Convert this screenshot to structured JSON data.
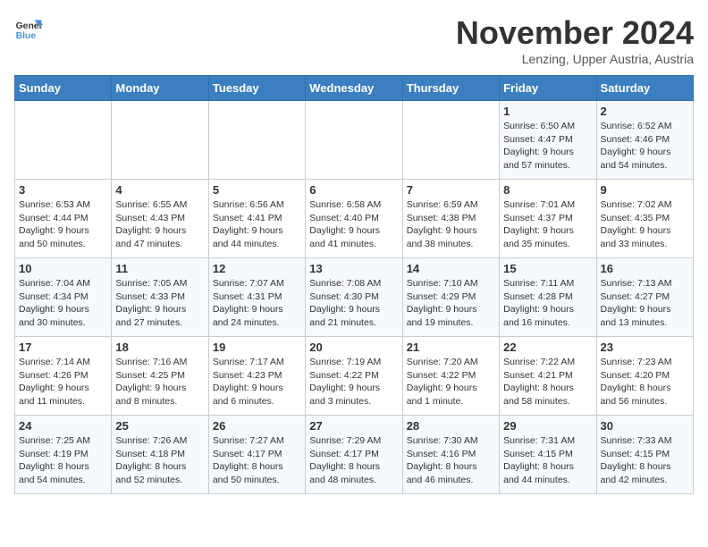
{
  "header": {
    "logo_line1": "General",
    "logo_line2": "Blue",
    "month_title": "November 2024",
    "location": "Lenzing, Upper Austria, Austria"
  },
  "days_of_week": [
    "Sunday",
    "Monday",
    "Tuesday",
    "Wednesday",
    "Thursday",
    "Friday",
    "Saturday"
  ],
  "weeks": [
    [
      {
        "day": "",
        "info": ""
      },
      {
        "day": "",
        "info": ""
      },
      {
        "day": "",
        "info": ""
      },
      {
        "day": "",
        "info": ""
      },
      {
        "day": "",
        "info": ""
      },
      {
        "day": "1",
        "info": "Sunrise: 6:50 AM\nSunset: 4:47 PM\nDaylight: 9 hours\nand 57 minutes."
      },
      {
        "day": "2",
        "info": "Sunrise: 6:52 AM\nSunset: 4:46 PM\nDaylight: 9 hours\nand 54 minutes."
      }
    ],
    [
      {
        "day": "3",
        "info": "Sunrise: 6:53 AM\nSunset: 4:44 PM\nDaylight: 9 hours\nand 50 minutes."
      },
      {
        "day": "4",
        "info": "Sunrise: 6:55 AM\nSunset: 4:43 PM\nDaylight: 9 hours\nand 47 minutes."
      },
      {
        "day": "5",
        "info": "Sunrise: 6:56 AM\nSunset: 4:41 PM\nDaylight: 9 hours\nand 44 minutes."
      },
      {
        "day": "6",
        "info": "Sunrise: 6:58 AM\nSunset: 4:40 PM\nDaylight: 9 hours\nand 41 minutes."
      },
      {
        "day": "7",
        "info": "Sunrise: 6:59 AM\nSunset: 4:38 PM\nDaylight: 9 hours\nand 38 minutes."
      },
      {
        "day": "8",
        "info": "Sunrise: 7:01 AM\nSunset: 4:37 PM\nDaylight: 9 hours\nand 35 minutes."
      },
      {
        "day": "9",
        "info": "Sunrise: 7:02 AM\nSunset: 4:35 PM\nDaylight: 9 hours\nand 33 minutes."
      }
    ],
    [
      {
        "day": "10",
        "info": "Sunrise: 7:04 AM\nSunset: 4:34 PM\nDaylight: 9 hours\nand 30 minutes."
      },
      {
        "day": "11",
        "info": "Sunrise: 7:05 AM\nSunset: 4:33 PM\nDaylight: 9 hours\nand 27 minutes."
      },
      {
        "day": "12",
        "info": "Sunrise: 7:07 AM\nSunset: 4:31 PM\nDaylight: 9 hours\nand 24 minutes."
      },
      {
        "day": "13",
        "info": "Sunrise: 7:08 AM\nSunset: 4:30 PM\nDaylight: 9 hours\nand 21 minutes."
      },
      {
        "day": "14",
        "info": "Sunrise: 7:10 AM\nSunset: 4:29 PM\nDaylight: 9 hours\nand 19 minutes."
      },
      {
        "day": "15",
        "info": "Sunrise: 7:11 AM\nSunset: 4:28 PM\nDaylight: 9 hours\nand 16 minutes."
      },
      {
        "day": "16",
        "info": "Sunrise: 7:13 AM\nSunset: 4:27 PM\nDaylight: 9 hours\nand 13 minutes."
      }
    ],
    [
      {
        "day": "17",
        "info": "Sunrise: 7:14 AM\nSunset: 4:26 PM\nDaylight: 9 hours\nand 11 minutes."
      },
      {
        "day": "18",
        "info": "Sunrise: 7:16 AM\nSunset: 4:25 PM\nDaylight: 9 hours\nand 8 minutes."
      },
      {
        "day": "19",
        "info": "Sunrise: 7:17 AM\nSunset: 4:23 PM\nDaylight: 9 hours\nand 6 minutes."
      },
      {
        "day": "20",
        "info": "Sunrise: 7:19 AM\nSunset: 4:22 PM\nDaylight: 9 hours\nand 3 minutes."
      },
      {
        "day": "21",
        "info": "Sunrise: 7:20 AM\nSunset: 4:22 PM\nDaylight: 9 hours\nand 1 minute."
      },
      {
        "day": "22",
        "info": "Sunrise: 7:22 AM\nSunset: 4:21 PM\nDaylight: 8 hours\nand 58 minutes."
      },
      {
        "day": "23",
        "info": "Sunrise: 7:23 AM\nSunset: 4:20 PM\nDaylight: 8 hours\nand 56 minutes."
      }
    ],
    [
      {
        "day": "24",
        "info": "Sunrise: 7:25 AM\nSunset: 4:19 PM\nDaylight: 8 hours\nand 54 minutes."
      },
      {
        "day": "25",
        "info": "Sunrise: 7:26 AM\nSunset: 4:18 PM\nDaylight: 8 hours\nand 52 minutes."
      },
      {
        "day": "26",
        "info": "Sunrise: 7:27 AM\nSunset: 4:17 PM\nDaylight: 8 hours\nand 50 minutes."
      },
      {
        "day": "27",
        "info": "Sunrise: 7:29 AM\nSunset: 4:17 PM\nDaylight: 8 hours\nand 48 minutes."
      },
      {
        "day": "28",
        "info": "Sunrise: 7:30 AM\nSunset: 4:16 PM\nDaylight: 8 hours\nand 46 minutes."
      },
      {
        "day": "29",
        "info": "Sunrise: 7:31 AM\nSunset: 4:15 PM\nDaylight: 8 hours\nand 44 minutes."
      },
      {
        "day": "30",
        "info": "Sunrise: 7:33 AM\nSunset: 4:15 PM\nDaylight: 8 hours\nand 42 minutes."
      }
    ]
  ]
}
